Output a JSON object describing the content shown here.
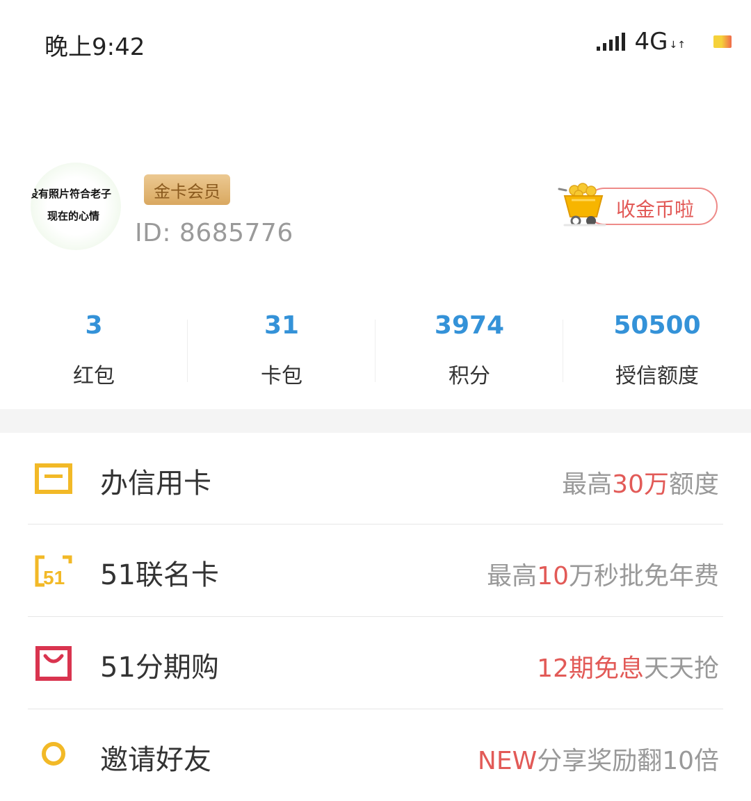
{
  "status_bar": {
    "time": "晚上9:42",
    "network": "4G",
    "network_arrows": "↓↑",
    "icons": [
      "signal-icon",
      "battery-icon"
    ]
  },
  "profile": {
    "avatar_text_line1": "没有照片符合老子",
    "avatar_text_line2": "现在的心情",
    "member_badge": "金卡会员",
    "id_text": "ID: 8685776",
    "coins_button": "收金币啦"
  },
  "stats": [
    {
      "value": "3",
      "label": "红包"
    },
    {
      "value": "31",
      "label": "卡包"
    },
    {
      "value": "3974",
      "label": "积分"
    },
    {
      "value": "50500",
      "label": "授信额度"
    }
  ],
  "menu": [
    {
      "label": "办信用卡",
      "desc_pre": "最高",
      "desc_hl": "30万",
      "desc_post": "额度",
      "icon": "credit-card-icon"
    },
    {
      "label": "51联名卡",
      "desc_pre": "最高",
      "desc_hl": "10",
      "desc_post": "万秒批免年费",
      "icon": "cobrand-card-icon"
    },
    {
      "label": "51分期购",
      "desc_pre": "",
      "desc_hl": "12期免息",
      "desc_post": "天天抢",
      "icon": "shopping-bag-icon"
    },
    {
      "label": "邀请好友",
      "desc_pre": "",
      "desc_hl": "NEW",
      "desc_post": "分享奖励翻10倍",
      "icon": "invite-friend-icon"
    }
  ],
  "colors": {
    "accent_blue": "#3492d8",
    "highlight_red": "#e25a57",
    "icon_yellow": "#f2b927",
    "icon_red": "#d9344f",
    "badge_gold": "#d9a860"
  }
}
